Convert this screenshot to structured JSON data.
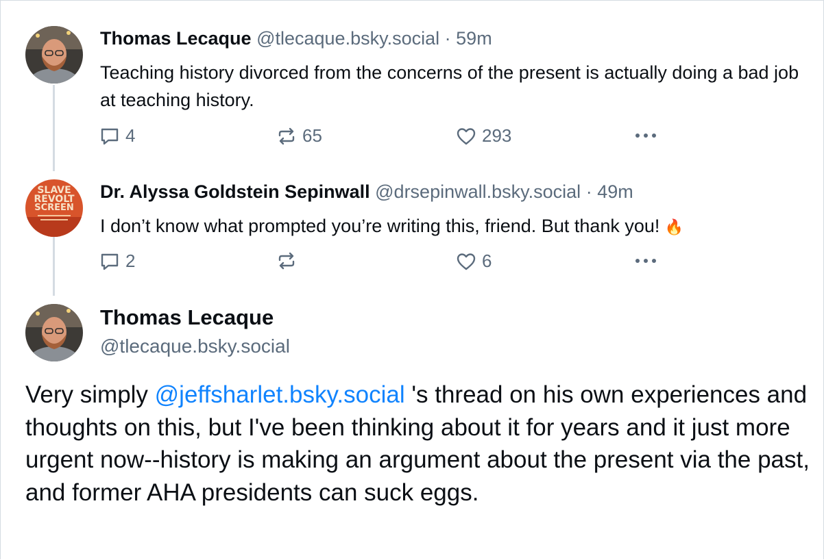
{
  "posts": [
    {
      "author_name": "Thomas Lecaque",
      "handle": "@tlecaque.bsky.social",
      "separator": "·",
      "time": "59m",
      "text": "Teaching history divorced from the concerns of the present is actually doing a bad job at teaching history.",
      "actions": {
        "reply_count": "4",
        "repost_count": "65",
        "like_count": "293"
      }
    },
    {
      "author_name": "Dr. Alyssa Goldstein Sepinwall",
      "handle": "@drsepinwall.bsky.social",
      "separator": "·",
      "time": "49m",
      "text": "I don’t know what prompted you’re writing this, friend. But thank you! ",
      "emoji": "🔥",
      "avatar_text": [
        "SLAVE",
        "REVOLT",
        "SCREEN"
      ],
      "actions": {
        "reply_count": "2",
        "repost_count": "",
        "like_count": "6"
      }
    }
  ],
  "focused_post": {
    "author_name": "Thomas Lecaque",
    "handle": "@tlecaque.bsky.social",
    "text_before": "Very simply ",
    "mention": "@jeffsharlet.bsky.social",
    "text_after": " 's thread on his own experiences and thoughts on this, but I've been thinking about it for years and it just more urgent now--history is making an argument about the present via the past, and former AHA presidents can suck eggs."
  },
  "icons": {
    "reply": "speech-bubble-icon",
    "repost": "repost-arrows-icon",
    "like": "heart-icon",
    "more": "ellipsis-icon"
  },
  "colors": {
    "text": "#0b0f14",
    "muted": "#5b6b7c",
    "link": "#1083fe",
    "thread_line": "#d4dbe2"
  }
}
